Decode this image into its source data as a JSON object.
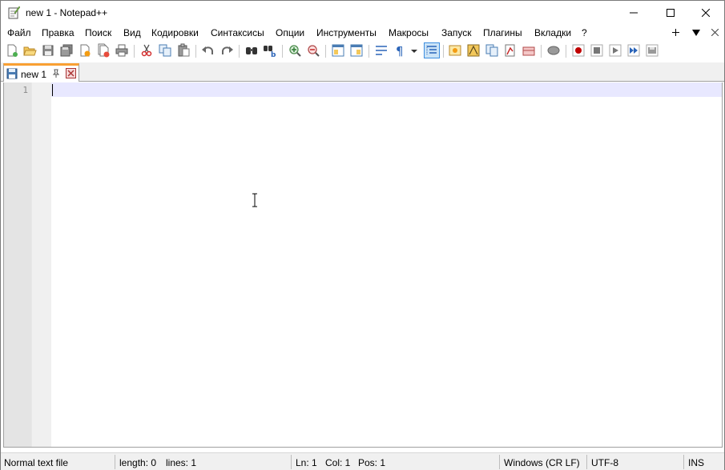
{
  "window": {
    "title": "new 1 - Notepad++",
    "app_icon": "notepad-icon",
    "controls": [
      "minimize-icon",
      "maximize-icon",
      "close-icon"
    ]
  },
  "menu": {
    "items": [
      "Файл",
      "Правка",
      "Поиск",
      "Вид",
      "Кодировки",
      "Синтаксисы",
      "Опции",
      "Инструменты",
      "Макросы",
      "Запуск",
      "Плагины",
      "Вкладки",
      "?"
    ],
    "right_icons": [
      "plus-icon",
      "dropdown-arrow-icon",
      "close-doc-icon"
    ]
  },
  "toolbar": {
    "icons": [
      "new-file-icon",
      "open-file-icon",
      "save-icon",
      "save-all-icon",
      "close-icon",
      "close-all-icon",
      "print-icon",
      "cut-icon",
      "copy-icon",
      "paste-icon",
      "undo-icon",
      "redo-icon",
      "find-icon",
      "replace-icon",
      "zoom-in-icon",
      "zoom-out-icon",
      "sync-vertical-icon",
      "sync-horizontal-icon",
      "word-wrap-icon",
      "show-all-chars-icon",
      "indent-guide-icon",
      "folder-as-workspace-icon",
      "doc-map-icon",
      "function-list-icon",
      "doc-list-icon",
      "monitoring-icon",
      "folder-icon",
      "stop-record-icon",
      "record-macro-icon",
      "stop-macro-icon",
      "play-macro-icon",
      "run-macro-multiple-icon",
      "save-macro-icon"
    ]
  },
  "tabs": [
    {
      "label": "new 1",
      "active": true
    }
  ],
  "editor": {
    "line_numbers": [
      "1"
    ],
    "content": ""
  },
  "status": {
    "file_type": "Normal text file",
    "length": "length: 0",
    "lines": "lines: 1",
    "ln": "Ln: 1",
    "col": "Col: 1",
    "pos": "Pos: 1",
    "eol": "Windows (CR LF)",
    "encoding": "UTF-8",
    "mode": "INS"
  },
  "colors": {
    "tab_accent": "#f9a033",
    "current_line": "#e8e8ff",
    "gutter": "#e4e4e4",
    "record_red": "#c00000"
  }
}
